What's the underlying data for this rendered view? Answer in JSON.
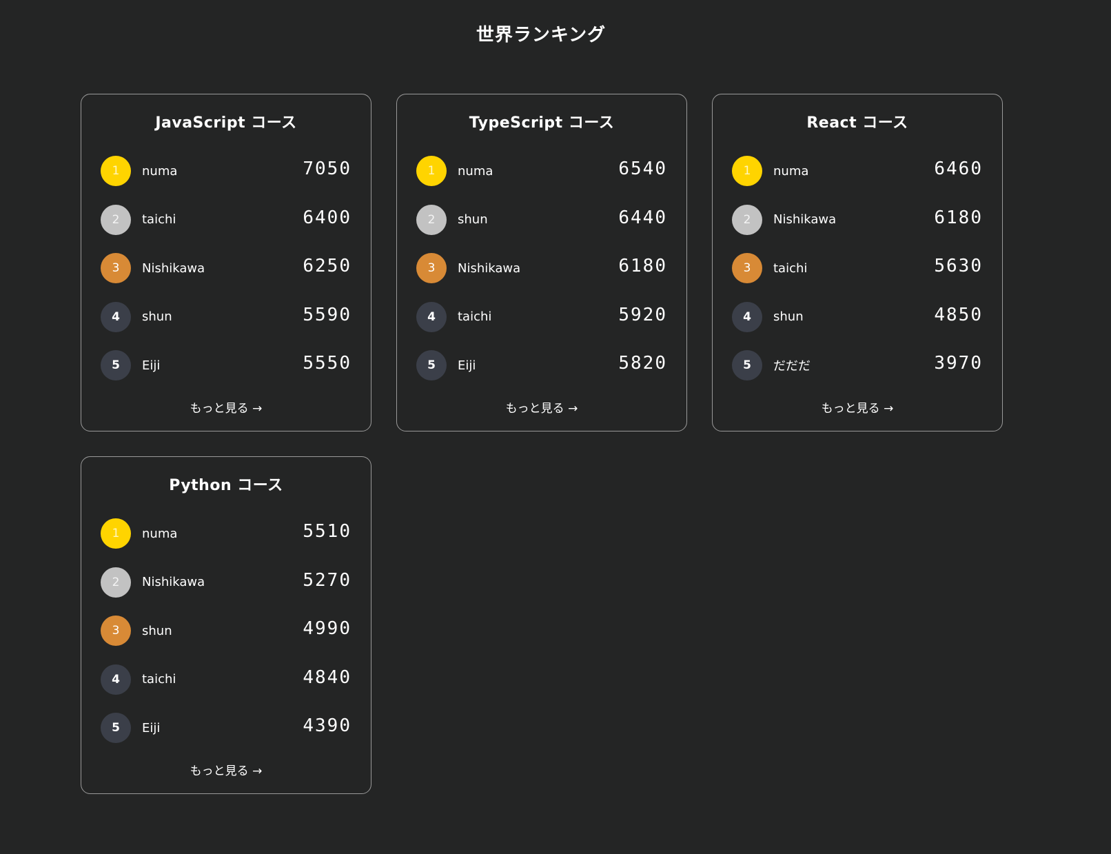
{
  "page": {
    "title": "世界ランキング"
  },
  "more_label": "もっと見る →",
  "colors": {
    "background": "#242525",
    "gold": "#ffd400",
    "silver": "#c2c2c2",
    "bronze": "#d88a36",
    "other": "#3b3f49"
  },
  "courses": [
    {
      "title": "JavaScript コース",
      "rows": [
        {
          "rank": "1",
          "name": "numa",
          "score": "7050"
        },
        {
          "rank": "2",
          "name": "taichi",
          "score": "6400"
        },
        {
          "rank": "3",
          "name": "Nishikawa",
          "score": "6250"
        },
        {
          "rank": "4",
          "name": "shun",
          "score": "5590"
        },
        {
          "rank": "5",
          "name": "Eiji",
          "score": "5550"
        }
      ]
    },
    {
      "title": "TypeScript コース",
      "rows": [
        {
          "rank": "1",
          "name": "numa",
          "score": "6540"
        },
        {
          "rank": "2",
          "name": "shun",
          "score": "6440"
        },
        {
          "rank": "3",
          "name": "Nishikawa",
          "score": "6180"
        },
        {
          "rank": "4",
          "name": "taichi",
          "score": "5920"
        },
        {
          "rank": "5",
          "name": "Eiji",
          "score": "5820"
        }
      ]
    },
    {
      "title": "React コース",
      "rows": [
        {
          "rank": "1",
          "name": "numa",
          "score": "6460"
        },
        {
          "rank": "2",
          "name": "Nishikawa",
          "score": "6180"
        },
        {
          "rank": "3",
          "name": "taichi",
          "score": "5630"
        },
        {
          "rank": "4",
          "name": "shun",
          "score": "4850"
        },
        {
          "rank": "5",
          "name": "だだだ",
          "score": "3970"
        }
      ]
    },
    {
      "title": "Python コース",
      "rows": [
        {
          "rank": "1",
          "name": "numa",
          "score": "5510"
        },
        {
          "rank": "2",
          "name": "Nishikawa",
          "score": "5270"
        },
        {
          "rank": "3",
          "name": "shun",
          "score": "4990"
        },
        {
          "rank": "4",
          "name": "taichi",
          "score": "4840"
        },
        {
          "rank": "5",
          "name": "Eiji",
          "score": "4390"
        }
      ]
    }
  ]
}
